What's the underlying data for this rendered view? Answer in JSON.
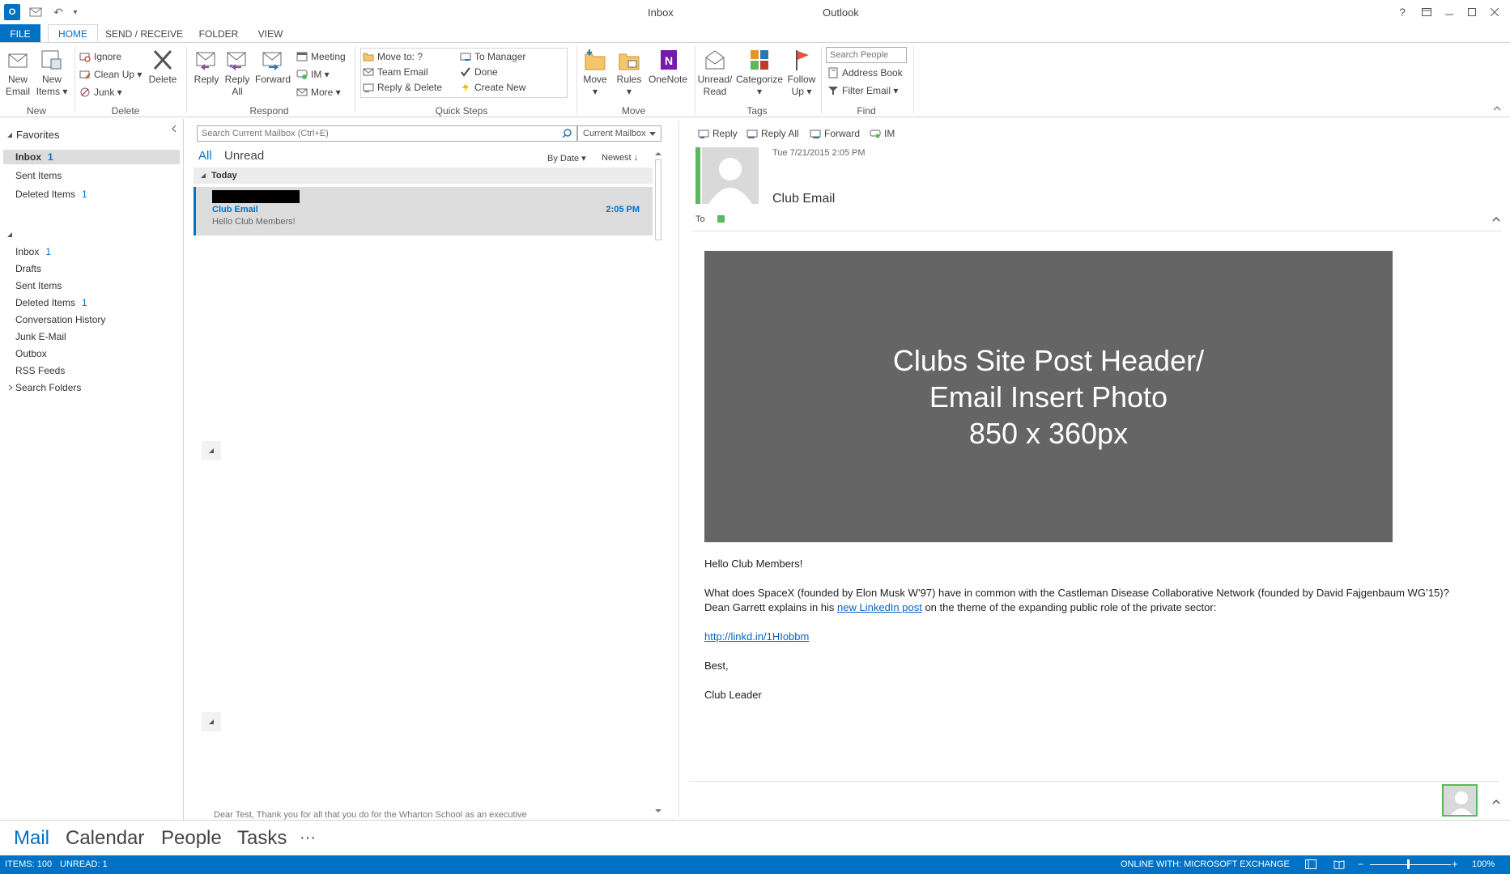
{
  "window": {
    "title_left": "Inbox",
    "title_right": "Outlook",
    "help": "?",
    "qa_undo": "↶",
    "qa_customize": "▾"
  },
  "tabs": [
    "FILE",
    "HOME",
    "SEND / RECEIVE",
    "FOLDER",
    "VIEW"
  ],
  "ribbon": {
    "new": {
      "new_email": "New\nEmail",
      "new_items": "New\nItems ▾",
      "label": "New"
    },
    "delete": {
      "ignore": "Ignore",
      "cleanup": "Clean Up ▾",
      "junk": "Junk ▾",
      "delete": "Delete",
      "label": "Delete"
    },
    "respond": {
      "reply": "Reply",
      "reply_all": "Reply\nAll",
      "forward": "Forward",
      "meeting": "Meeting",
      "im": "IM ▾",
      "more": "More ▾",
      "label": "Respond"
    },
    "quicksteps": {
      "move_to": "Move to: ?",
      "team_email": "Team Email",
      "reply_delete": "Reply & Delete",
      "to_manager": "To Manager",
      "done": "Done",
      "create_new": "Create New",
      "label": "Quick Steps"
    },
    "move": {
      "move": "Move\n▾",
      "rules": "Rules\n▾",
      "onenote": "OneNote",
      "label": "Move"
    },
    "tags": {
      "unread_read": "Unread/\nRead",
      "categorize": "Categorize\n▾",
      "follow_up": "Follow\nUp ▾",
      "label": "Tags"
    },
    "find": {
      "search_people_placeholder": "Search People",
      "address_book": "Address Book",
      "filter_email": "Filter Email ▾",
      "label": "Find"
    }
  },
  "folder_pane": {
    "favorites_header": "Favorites",
    "favorites": [
      {
        "name": "Inbox",
        "count": "1"
      },
      {
        "name": "Sent Items",
        "count": ""
      },
      {
        "name": "Deleted Items",
        "count": "1"
      }
    ],
    "folders": [
      {
        "name": "Inbox",
        "count": "1"
      },
      {
        "name": "Drafts",
        "count": ""
      },
      {
        "name": "Sent Items",
        "count": ""
      },
      {
        "name": "Deleted Items",
        "count": "1"
      },
      {
        "name": "Conversation History",
        "count": ""
      },
      {
        "name": "Junk E-Mail",
        "count": ""
      },
      {
        "name": "Outbox",
        "count": ""
      },
      {
        "name": "RSS Feeds",
        "count": ""
      },
      {
        "name": "Search Folders",
        "count": ""
      }
    ]
  },
  "message_list": {
    "search_placeholder": "Search Current Mailbox (Ctrl+E)",
    "scope": "Current Mailbox",
    "filter_all": "All",
    "filter_unread": "Unread",
    "sort_by": "By Date ▾",
    "sort_order": "Newest ↓",
    "group_today": "Today",
    "selected": {
      "subject": "Club Email",
      "preview": "Hello Club Members!",
      "time": "2:05 PM"
    },
    "bottom_preview": "Dear Test,  Thank you for all that you do for the Wharton School as an executive"
  },
  "reading_pane": {
    "actions": {
      "reply": "Reply",
      "reply_all": "Reply All",
      "forward": "Forward",
      "im": "IM"
    },
    "date": "Tue 7/21/2015 2:05 PM",
    "subject": "Club Email",
    "to_label": "To",
    "hero_lines": [
      "Clubs Site Post Header/",
      "Email Insert Photo",
      "850 x 360px"
    ],
    "greeting": "Hello Club Members!",
    "para1_a": "What does SpaceX (founded by Elon Musk W’97) have in common with the Castleman Disease Collaborative Network (founded by David Fajgenbaum WG’15)? Dean Garrett explains in his ",
    "para1_link": "new LinkedIn post",
    "para1_b": " on the theme of the expanding public role of the private sector:",
    "url": "http://linkd.in/1HIobbm",
    "closing": "Best,",
    "signature": "Club Leader"
  },
  "navbar": {
    "mail": "Mail",
    "calendar": "Calendar",
    "people": "People",
    "tasks": "Tasks",
    "more": "···"
  },
  "statusbar": {
    "items": "ITEMS: 100",
    "unread": "UNREAD: 1",
    "connection": "ONLINE WITH: MICROSOFT EXCHANGE",
    "zoom": "100%"
  },
  "colors": {
    "accent": "#0072c6",
    "hero": "#656565",
    "presence": "#5cb85c"
  }
}
